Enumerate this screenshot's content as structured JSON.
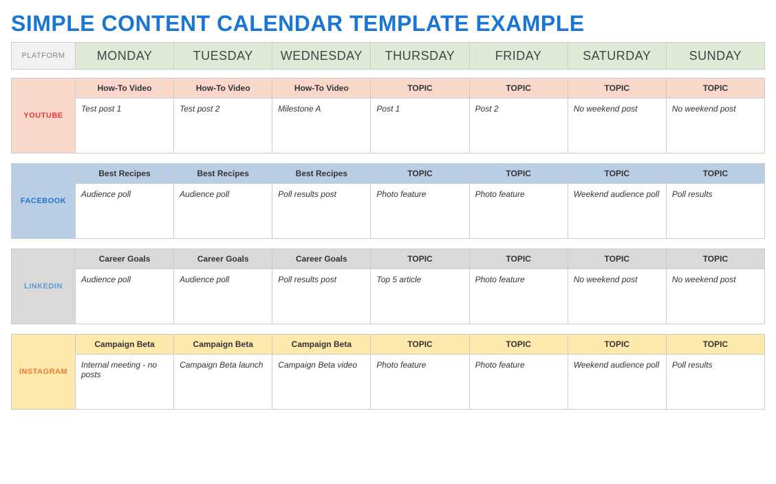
{
  "title": "SIMPLE CONTENT CALENDAR TEMPLATE EXAMPLE",
  "header": {
    "platform_label": "PLATFORM",
    "days": [
      "MONDAY",
      "TUESDAY",
      "WEDNESDAY",
      "THURSDAY",
      "FRIDAY",
      "SATURDAY",
      "SUNDAY"
    ]
  },
  "platforms": [
    {
      "name": "YOUTUBE",
      "color": "#E53935",
      "bg": "#F9D8CB",
      "topics": [
        "How-To Video",
        "How-To Video",
        "How-To Video",
        "TOPIC",
        "TOPIC",
        "TOPIC",
        "TOPIC"
      ],
      "content": [
        "Test post 1",
        "Test post 2",
        "Milestone A",
        "Post 1",
        "Post 2",
        "No weekend post",
        "No weekend post"
      ]
    },
    {
      "name": "FACEBOOK",
      "color": "#1976D2",
      "bg": "#B9CDE5",
      "topics": [
        "Best Recipes",
        "Best Recipes",
        "Best Recipes",
        "TOPIC",
        "TOPIC",
        "TOPIC",
        "TOPIC"
      ],
      "content": [
        "Audience poll",
        "Audience poll",
        "Poll results post",
        "Photo feature",
        "Photo feature",
        "Weekend audience poll",
        "Poll results"
      ]
    },
    {
      "name": "LINKEDIN",
      "color": "#5B9BD5",
      "bg": "#D9D9D9",
      "topics": [
        "Career Goals",
        "Career Goals",
        "Career Goals",
        "TOPIC",
        "TOPIC",
        "TOPIC",
        "TOPIC"
      ],
      "content": [
        "Audience poll",
        "Audience poll",
        "Poll results post",
        "Top 5 article",
        "Photo feature",
        "No weekend post",
        "No weekend post"
      ]
    },
    {
      "name": "INSTAGRAM",
      "color": "#ED7D31",
      "bg": "#FDE9AC",
      "topics": [
        "Campaign Beta",
        "Campaign Beta",
        "Campaign Beta",
        "TOPIC",
        "TOPIC",
        "TOPIC",
        "TOPIC"
      ],
      "content": [
        "Internal meeting - no posts",
        "Campaign Beta launch",
        "Campaign Beta video",
        "Photo feature",
        "Photo feature",
        "Weekend audience poll",
        "Poll results"
      ]
    }
  ]
}
